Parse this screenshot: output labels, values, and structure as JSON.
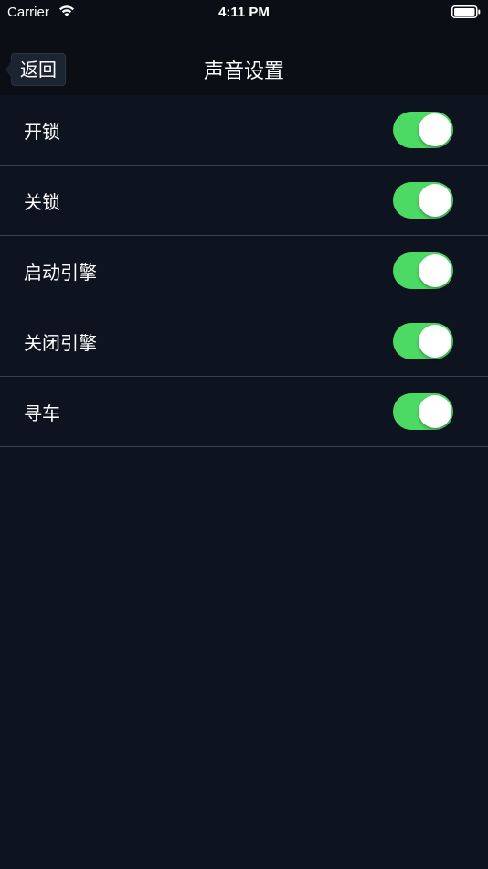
{
  "status_bar": {
    "carrier": "Carrier",
    "time": "4:11 PM",
    "wifi_icon": "wifi-icon",
    "battery_icon": "battery-icon"
  },
  "nav": {
    "back_label": "返回",
    "title": "声音设置"
  },
  "settings": [
    {
      "label": "开锁",
      "enabled": true
    },
    {
      "label": "关锁",
      "enabled": true
    },
    {
      "label": "启动引擎",
      "enabled": true
    },
    {
      "label": "关闭引擎",
      "enabled": true
    },
    {
      "label": "寻车",
      "enabled": true
    }
  ],
  "colors": {
    "background": "#0e1320",
    "bar_background": "#0b0f15",
    "toggle_on": "#4cd964",
    "separator": "#3a414c"
  }
}
